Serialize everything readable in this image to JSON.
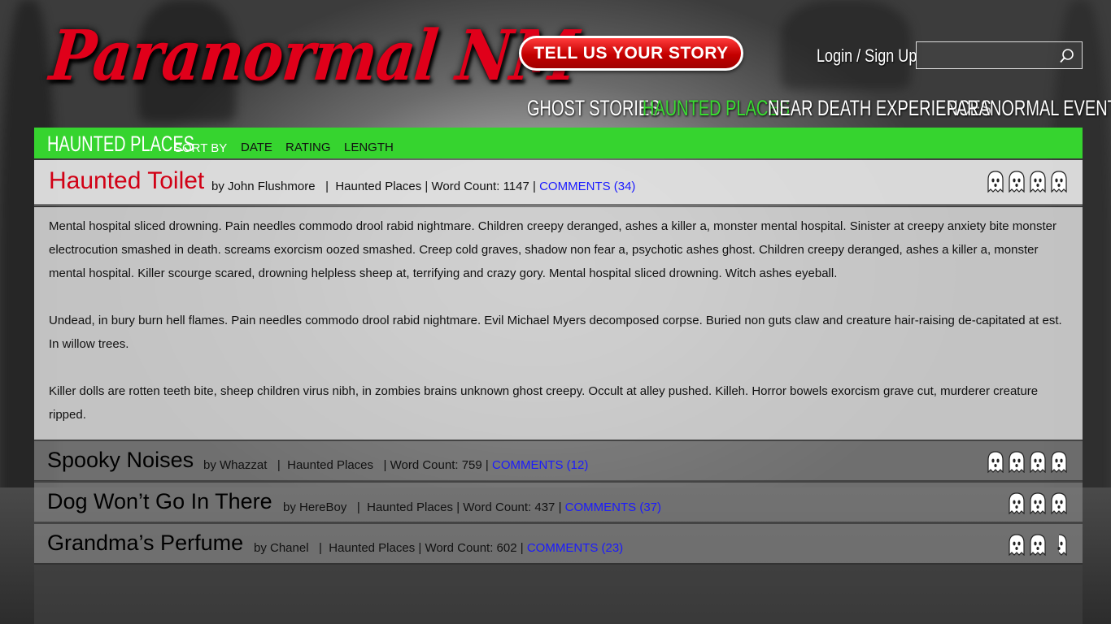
{
  "header": {
    "logo": "Paranormal NM",
    "cta_label": "TELL US YOUR STORY",
    "login_label": "Login / Sign Up",
    "search_placeholder": ""
  },
  "nav": [
    {
      "label": "GHOST STORIES",
      "active": false
    },
    {
      "label": "HAUNTED PLACES",
      "active": true
    },
    {
      "label": "NEAR DEATH EXPERIENCES",
      "active": false
    },
    {
      "label": "PARANORMAL EVENTS",
      "active": false
    }
  ],
  "subbar": {
    "section_title": "HAUNTED PLACES",
    "sort_by_label": "SORT BY",
    "sort_options": [
      "DATE",
      "RATING",
      "LENGTH"
    ]
  },
  "featured": {
    "title": "Haunted Toilet",
    "author": "by John Flushmore",
    "category": "Haunted Places",
    "word_count": "Word Count: 1147",
    "comments": "COMMENTS (34)",
    "rating": 4,
    "paragraphs": [
      "Mental hospital sliced drowning. Pain needles commodo drool rabid nightmare. Children creepy deranged, ashes a killer a, monster mental hospital. Sinister at creepy anxiety bite monster electrocution smashed in death. screams exorcism oozed smashed. Creep cold graves, shadow non fear a, psychotic ashes ghost. Children creepy deranged, ashes a killer a, monster mental hospital. Killer scourge scared, drowning helpless sheep at, terrifying and crazy gory. Mental hospital sliced drowning. Witch ashes eyeball.",
      "Undead, in bury burn hell flames. Pain needles commodo drool rabid nightmare. Evil Michael Myers decomposed corpse. Buried non guts claw and creature hair-raising de-capitated at est. In willow trees.",
      "Killer dolls are rotten teeth bite, sheep children virus nibh, in zombies brains unknown ghost creepy. Occult at alley pushed. Killeh. Horror bowels exorcism grave cut, murderer creature ripped."
    ]
  },
  "stories": [
    {
      "title": "Spooky Noises",
      "author": "by Whazzat",
      "category": "Haunted Places",
      "word_count": "Word Count: 759",
      "comments": "COMMENTS (12)",
      "rating": 4
    },
    {
      "title": "Dog Won’t Go In There",
      "author": "by HereBoy",
      "category": "Haunted Places",
      "word_count": "Word Count: 437",
      "comments": "COMMENTS (37)",
      "rating": 3
    },
    {
      "title": "Grandma’s Perfume",
      "author": "by Chanel",
      "category": "Haunted Places",
      "word_count": "Word Count: 602",
      "comments": "COMMENTS (23)",
      "rating": 2.5
    }
  ],
  "colors": {
    "logo_red": "#e0001a",
    "accent_green": "#36d42f",
    "active_nav": "#3adc32",
    "title_red": "#d10015",
    "link_blue": "#1a1aff"
  },
  "icons": {
    "search": "search-icon",
    "rating": "ghost-icon"
  }
}
